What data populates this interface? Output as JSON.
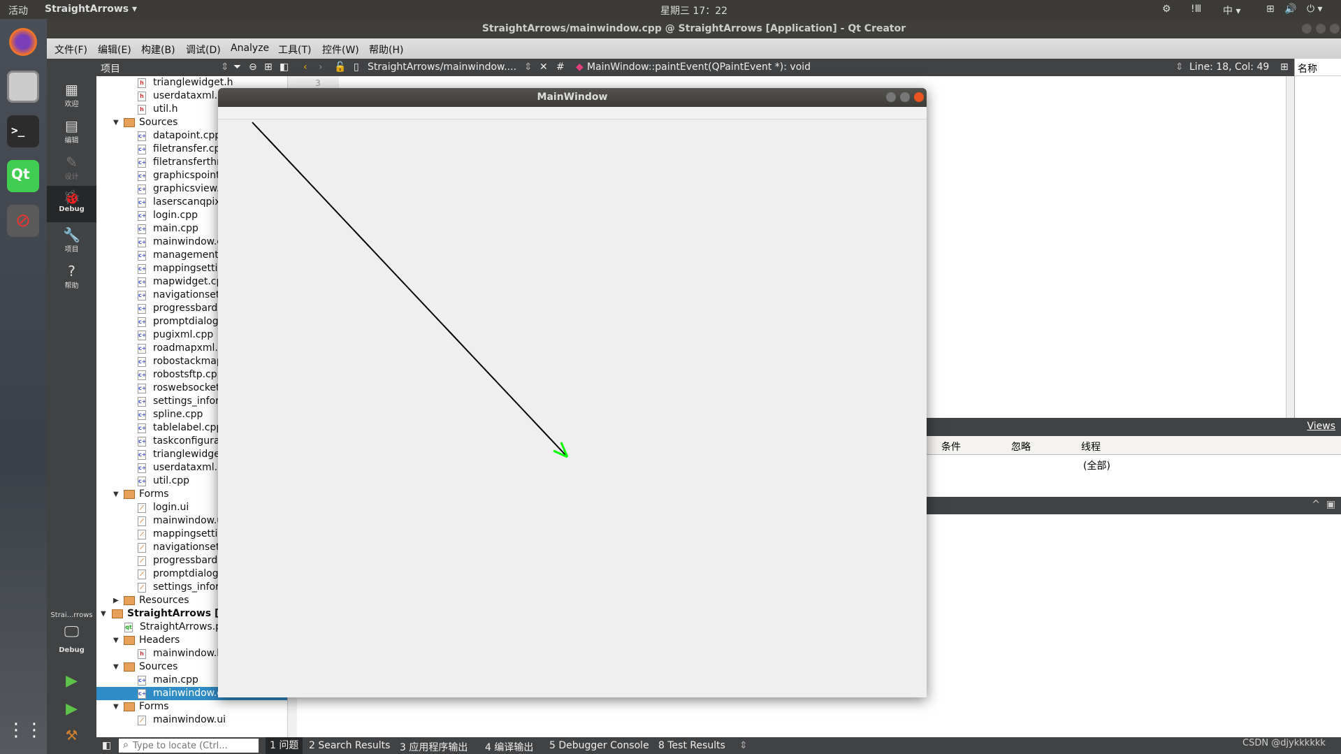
{
  "topbar": {
    "activities": "活动",
    "app": "StraightArrows ▾",
    "clock": "星期三 17：22",
    "tray": [
      "!Ⅲ",
      "中 ▾",
      "🔊",
      "⏻ ▾"
    ]
  },
  "window_title": "StraightArrows/mainwindow.cpp @ StraightArrows [Application] - Qt Creator",
  "menu": [
    "文件(F)",
    "编辑(E)",
    "构建(B)",
    "调试(D)",
    "Analyze",
    "工具(T)",
    "控件(W)",
    "帮助(H)"
  ],
  "modes": [
    {
      "label": "欢迎",
      "icon": "grid-icon",
      "glyph": "▦"
    },
    {
      "label": "编辑",
      "icon": "edit-icon",
      "glyph": "▤"
    },
    {
      "label": "设计",
      "icon": "pencil-icon",
      "glyph": "✎"
    },
    {
      "label": "Debug",
      "icon": "bug-icon",
      "glyph": "🐞"
    },
    {
      "label": "项目",
      "icon": "wrench-icon",
      "glyph": "🔧"
    },
    {
      "label": "帮助",
      "icon": "help-icon",
      "glyph": "?"
    }
  ],
  "kit": {
    "project": "Strai...rrows",
    "mode": "Debug"
  },
  "project_panel": {
    "title": "项目"
  },
  "tree": [
    {
      "t": "trianglewidget.h",
      "k": "h",
      "l": 3
    },
    {
      "t": "userdataxml.h",
      "k": "h",
      "l": 3
    },
    {
      "t": "util.h",
      "k": "h",
      "l": 3
    },
    {
      "t": "Sources",
      "k": "dir",
      "l": 2,
      "x": "▼"
    },
    {
      "t": "datapoint.cpp",
      "k": "c",
      "l": 3
    },
    {
      "t": "filetransfer.cp",
      "k": "c",
      "l": 3
    },
    {
      "t": "filetransferthr",
      "k": "c",
      "l": 3
    },
    {
      "t": "graphicspointv",
      "k": "c",
      "l": 3
    },
    {
      "t": "graphicsview.c",
      "k": "c",
      "l": 3
    },
    {
      "t": "laserscanqpixr",
      "k": "c",
      "l": 3
    },
    {
      "t": "login.cpp",
      "k": "c",
      "l": 3
    },
    {
      "t": "main.cpp",
      "k": "c",
      "l": 3
    },
    {
      "t": "mainwindow.c",
      "k": "c",
      "l": 3
    },
    {
      "t": "management.",
      "k": "c",
      "l": 3
    },
    {
      "t": "mappingsettin",
      "k": "c",
      "l": 3
    },
    {
      "t": "mapwidget.cp",
      "k": "c",
      "l": 3
    },
    {
      "t": "navigationsett",
      "k": "c",
      "l": 3
    },
    {
      "t": "progressbardi",
      "k": "c",
      "l": 3
    },
    {
      "t": "promptdialog.",
      "k": "c",
      "l": 3
    },
    {
      "t": "pugixml.cpp",
      "k": "c",
      "l": 3
    },
    {
      "t": "roadmapxml.c",
      "k": "c",
      "l": 3
    },
    {
      "t": "robostackmap",
      "k": "c",
      "l": 3
    },
    {
      "t": "robostsftp.cpp",
      "k": "c",
      "l": 3
    },
    {
      "t": "roswebsocket",
      "k": "c",
      "l": 3
    },
    {
      "t": "settings_infor",
      "k": "c",
      "l": 3
    },
    {
      "t": "spline.cpp",
      "k": "c",
      "l": 3
    },
    {
      "t": "tablelabel.cpp",
      "k": "c",
      "l": 3
    },
    {
      "t": "taskconfigurat",
      "k": "c",
      "l": 3
    },
    {
      "t": "trianglewidge",
      "k": "c",
      "l": 3
    },
    {
      "t": "userdataxml.c",
      "k": "c",
      "l": 3
    },
    {
      "t": "util.cpp",
      "k": "c",
      "l": 3
    },
    {
      "t": "Forms",
      "k": "dir",
      "l": 2,
      "x": "▼"
    },
    {
      "t": "login.ui",
      "k": "ui",
      "l": 3
    },
    {
      "t": "mainwindow.u",
      "k": "ui",
      "l": 3
    },
    {
      "t": "mappingsettin",
      "k": "ui",
      "l": 3
    },
    {
      "t": "navigationsett",
      "k": "ui",
      "l": 3
    },
    {
      "t": "progressbardi",
      "k": "ui",
      "l": 3
    },
    {
      "t": "promptdialog.",
      "k": "ui",
      "l": 3
    },
    {
      "t": "settings_infor",
      "k": "ui",
      "l": 3
    },
    {
      "t": "Resources",
      "k": "dir",
      "l": 2,
      "x": "▶"
    },
    {
      "t": "StraightArrows [Ap",
      "k": "dir",
      "l": 1,
      "x": "▼",
      "b": true
    },
    {
      "t": "StraightArrows.p",
      "k": "pro",
      "l": 2
    },
    {
      "t": "Headers",
      "k": "dir",
      "l": 2,
      "x": "▼"
    },
    {
      "t": "mainwindow.h",
      "k": "h",
      "l": 3
    },
    {
      "t": "Sources",
      "k": "dir",
      "l": 2,
      "x": "▼"
    },
    {
      "t": "main.cpp",
      "k": "c",
      "l": 3
    },
    {
      "t": "mainwindow.c",
      "k": "c",
      "l": 3,
      "sel": true
    },
    {
      "t": "Forms",
      "k": "dir",
      "l": 2,
      "x": "▼"
    },
    {
      "t": "mainwindow.ui",
      "k": "ui",
      "l": 3
    }
  ],
  "editor_toolbar": {
    "file": "StraightArrows/mainwindow....",
    "hash": "#",
    "symbol": "MainWindow::paintEvent(QPaintEvent *): void",
    "position": "Line: 18, Col: 49"
  },
  "gutter_line": "3",
  "right_pane": {
    "header": "名称"
  },
  "debug": {
    "views": "Views",
    "columns": [
      "条件",
      "忽略",
      "线程"
    ],
    "row": [
      "",
      "",
      "(全部)"
    ]
  },
  "status": {
    "locate_placeholder": "Type to locate (Ctrl...",
    "tabs": [
      "1 问题",
      "2 Search Results",
      "3 应用程序输出",
      "4 编译输出",
      "5 Debugger Console",
      "8 Test Results"
    ],
    "watermark": "CSDN @djykkkkkk"
  },
  "app_window": {
    "title": "MainWindow",
    "arrow_color": "#000000",
    "arrowhead_color": "#00ff00"
  }
}
